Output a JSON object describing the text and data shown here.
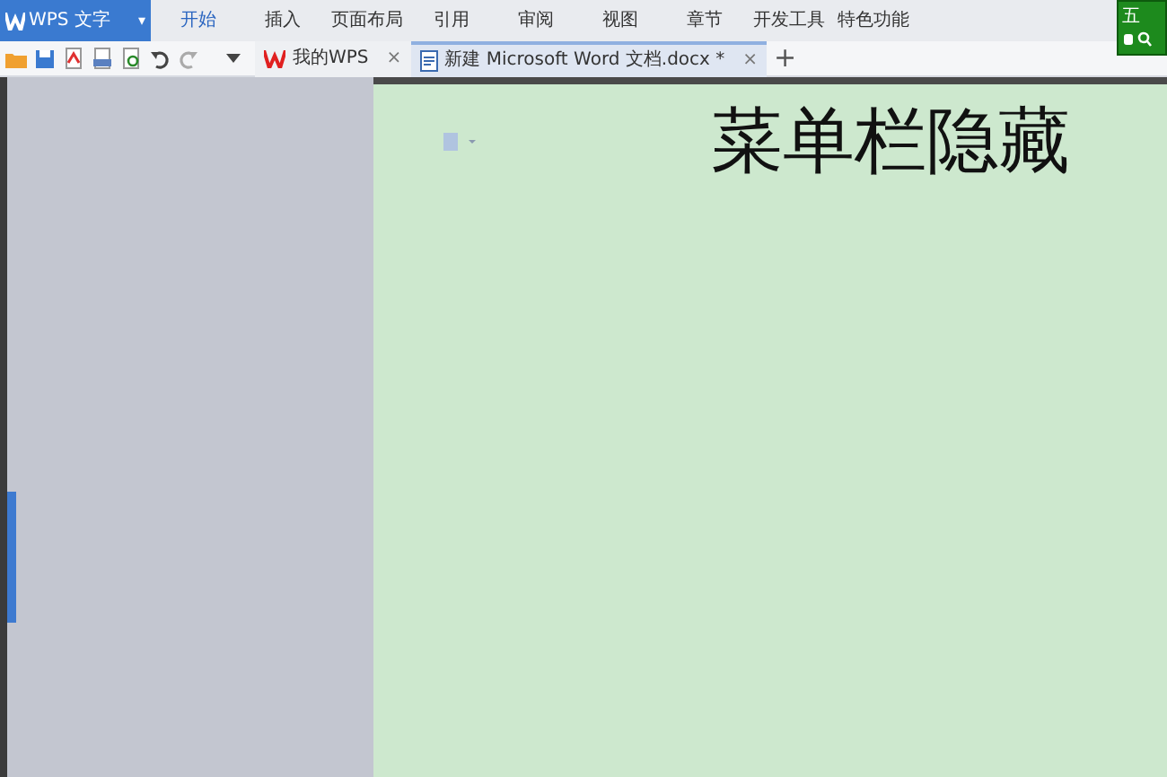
{
  "app_button": {
    "label": "WPS 文字",
    "caret": "▾"
  },
  "menu_tabs": [
    {
      "label": "开始",
      "selected": true
    },
    {
      "label": "插入",
      "selected": false
    },
    {
      "label": "页面布局",
      "selected": false
    },
    {
      "label": "引用",
      "selected": false
    },
    {
      "label": "审阅",
      "selected": false
    },
    {
      "label": "视图",
      "selected": false
    },
    {
      "label": "章节",
      "selected": false
    },
    {
      "label": "开发工具",
      "selected": false
    },
    {
      "label": "特色功能",
      "selected": false
    }
  ],
  "ime": {
    "label": "五"
  },
  "doc_tabs": [
    {
      "label": "我的WPS",
      "selected": false,
      "close": "×"
    },
    {
      "label": "新建 Microsoft Word 文档.docx *",
      "selected": true,
      "close": "×"
    }
  ],
  "new_tab": "+",
  "document": {
    "heading": "菜单栏隐藏"
  }
}
